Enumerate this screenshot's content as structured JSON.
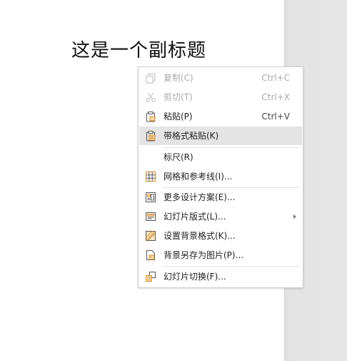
{
  "slide": {
    "subtitle": "这是一个副标题"
  },
  "context_menu": {
    "items": [
      {
        "id": "copy",
        "label": "复制(C)",
        "shortcut": "Ctrl+C",
        "icon": "copy-icon",
        "enabled": false
      },
      {
        "id": "cut",
        "label": "剪切(T)",
        "shortcut": "Ctrl+X",
        "icon": "scissors-icon",
        "enabled": false
      },
      {
        "id": "paste",
        "label": "粘贴(P)",
        "shortcut": "Ctrl+V",
        "icon": "clipboard-icon",
        "enabled": true
      },
      {
        "id": "paste-formatted",
        "label": "带格式粘贴(K)",
        "shortcut": "",
        "icon": "clipboard-format-icon",
        "enabled": true,
        "highlighted": true
      },
      {
        "id": "ruler",
        "label": "标尺(R)",
        "shortcut": "",
        "icon": "",
        "enabled": true
      },
      {
        "id": "grid-guides",
        "label": "网格和参考线(I)...",
        "shortcut": "",
        "icon": "grid-icon",
        "enabled": true
      },
      {
        "id": "more-designs",
        "label": "更多设计方案(E)...",
        "shortcut": "",
        "icon": "design-icon",
        "enabled": true
      },
      {
        "id": "slide-layout",
        "label": "幻灯片版式(L)...",
        "shortcut": "",
        "icon": "layout-icon",
        "enabled": true,
        "submenu": true
      },
      {
        "id": "background-format",
        "label": "设置背景格式(K)...",
        "shortcut": "",
        "icon": "background-icon",
        "enabled": true
      },
      {
        "id": "save-background",
        "label": "背景另存为图片(P)...",
        "shortcut": "",
        "icon": "save-image-icon",
        "enabled": true
      },
      {
        "id": "slide-transition",
        "label": "幻灯片切换(F)...",
        "shortcut": "",
        "icon": "transition-icon",
        "enabled": true
      }
    ]
  }
}
